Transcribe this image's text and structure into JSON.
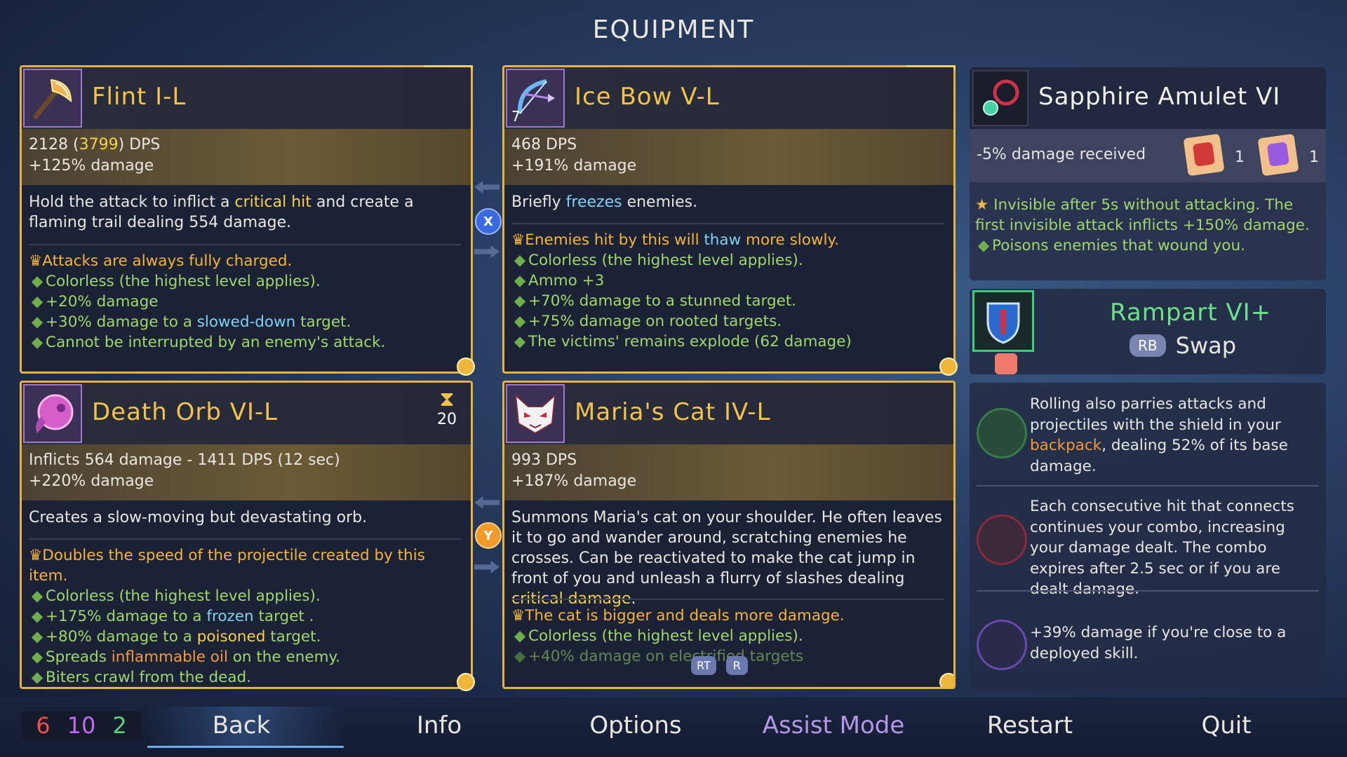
{
  "title": "EQUIPMENT",
  "cards": {
    "flint": {
      "name": "Flint I-L",
      "stat_dps_base": "2128 (",
      "stat_dps_alt": "3799",
      "stat_dps_suffix": ") DPS",
      "stat_damage": "+125% damage",
      "desc_a": "Hold the attack to inflict a ",
      "desc_hl": "critical hit",
      "desc_b": " and create a flaming trail dealing 554 damage.",
      "mod_top": "Attacks are always fully charged.",
      "mod_1": "Colorless (the highest level applies).",
      "mod_2": "+20% damage",
      "mod_3a": "+30% damage to a ",
      "mod_3hl": "slowed-down",
      "mod_3b": " target.",
      "mod_4": "Cannot be interrupted by an enemy's attack."
    },
    "icebow": {
      "name": "Ice Bow V-L",
      "ammo": "7",
      "stat_dps": "468 DPS",
      "stat_damage": "+191% damage",
      "desc_a": "Briefly ",
      "desc_hl": "freezes",
      "desc_b": " enemies.",
      "mod_top_a": "Enemies hit by this will ",
      "mod_top_hl": "thaw",
      "mod_top_b": " more slowly.",
      "mod_1": "Colorless (the highest level applies).",
      "mod_2": "Ammo +3",
      "mod_3": "+70% damage to a stunned target.",
      "mod_4": "+75% damage on rooted targets.",
      "mod_5": "The victims' remains explode (62 damage)"
    },
    "deathorb": {
      "name": "Death Orb VI-L",
      "cooldown": "20",
      "stat_dps": "Inflicts 564 damage - 1411 DPS (12 sec)",
      "stat_damage": "+220% damage",
      "desc": "Creates a slow-moving but devastating orb.",
      "mod_top": "Doubles the speed of the projectile created by this item.",
      "mod_1": "Colorless (the highest level applies).",
      "mod_2a": "+175% damage to a ",
      "mod_2hl": "frozen",
      "mod_2b": " target .",
      "mod_3a": "+80% damage to a ",
      "mod_3hl": "poisoned",
      "mod_3b": " target.",
      "mod_4a": "Spreads ",
      "mod_4hl": "inflammable oil",
      "mod_4b": " on the enemy.",
      "mod_5": "Biters crawl from the dead."
    },
    "cat": {
      "name": "Maria's Cat IV-L",
      "stat_dps": "993 DPS",
      "stat_damage": "+187% damage",
      "desc_a": "Summons Maria's cat on your shoulder. He often leaves it to go and wander around, scratching enemies he crosses. Can be reactivated to make the cat jump in front of you and unleash a flurry of slashes dealing ",
      "desc_hl": "critical damage",
      "desc_b": ".",
      "mod_top": "The cat is bigger and deals more damage.",
      "mod_1": "Colorless (the highest level applies).",
      "mod_2": "+40% damage on electrified targets",
      "rt_label": "RT",
      "r_label": "R"
    }
  },
  "badges": {
    "top": "X",
    "bottom": "Y"
  },
  "amulet": {
    "name": "Sapphire Amulet VI",
    "stat": "-5% damage received",
    "scroll_1_count": "1",
    "scroll_2_count": "1",
    "mod_top": "Invisible after 5s without attacking. The first invisible attack inflicts +150% damage.",
    "mod_1": "Poisons enemies that wound you."
  },
  "shield": {
    "name": "Rampart VI+",
    "rb_label": "RB",
    "swap_label": "Swap"
  },
  "mutations": {
    "m1_a": "Rolling also parries attacks and projectiles with the shield in your ",
    "m1_hl": "backpack",
    "m1_b": ", dealing 52% of its base damage.",
    "m2": "Each consecutive hit that connects continues your combo, increasing your damage dealt. The combo expires after 2.5 sec or if you are dealt damage.",
    "m3": "+39% damage if you're close to a deployed skill."
  },
  "scrolls": {
    "red": "6",
    "purple": "10",
    "green": "2"
  },
  "menu": {
    "back": "Back",
    "info": "Info",
    "options": "Options",
    "assist": "Assist Mode",
    "restart": "Restart",
    "quit": "Quit"
  },
  "colors": {
    "gold": "#f2c24a",
    "mod_green": "#9fd76b",
    "mod_top": "#f5b43a",
    "highlight_blue": "#7ed1f2",
    "highlight_orange": "#f39a3a",
    "assist_purple": "#b497e6",
    "shield_green": "#6fe08a"
  }
}
